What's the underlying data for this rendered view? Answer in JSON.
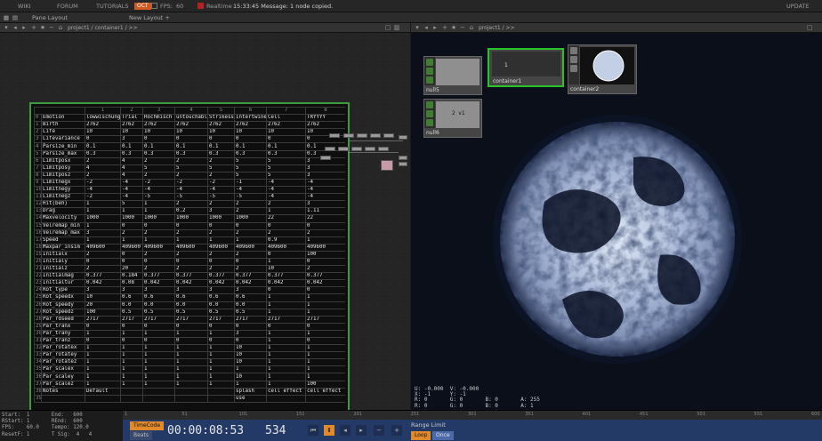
{
  "menu": {
    "wiki": "WIKI",
    "forum": "FORUM",
    "tutorials": "TUTORIALS",
    "oct_badge": "OCT",
    "fps_label": "FPS:",
    "fps_value": "60",
    "realtime": "Realtime",
    "message": "15:33:45 Message: 1 node copied.",
    "update": "UPDATE"
  },
  "panebar": {
    "pane_layout": "Pane Layout",
    "new_layout": "New Layout +"
  },
  "left_path": {
    "path": "project1 / container1 / >>"
  },
  "right_path": {
    "path": "project1 / >>"
  },
  "table": {
    "col_headers": [
      "",
      "1",
      "2",
      "3",
      "4",
      "5",
      "6",
      "7",
      "8"
    ],
    "rows": [
      [
        "0",
        "Emotion",
        "lowwischung",
        "Trial",
        "Hochmisch",
        "untouchable",
        "Strikess",
        "Intertwine",
        "Cell",
        "TRYYYY"
      ],
      [
        "1",
        "Birth",
        "2762",
        "2762",
        "2762",
        "2762",
        "2762",
        "2762",
        "2762",
        "2762"
      ],
      [
        "2",
        "Life",
        "10",
        "10",
        "10",
        "10",
        "10",
        "10",
        "10",
        "10"
      ],
      [
        "3",
        "Lifevariance",
        "0",
        "3",
        "0",
        "0",
        "0",
        "0",
        "0",
        "0"
      ],
      [
        "4",
        "Parsize_min",
        "0.1",
        "0.1",
        "0.1",
        "0.1",
        "0.1",
        "0.1",
        "0.1",
        "0.1"
      ],
      [
        "5",
        "Parsize_max",
        "0.3",
        "0.3",
        "0.3",
        "0.3",
        "0.3",
        "0.3",
        "0.3",
        "0.3"
      ],
      [
        "6",
        "Limitposx",
        "2",
        "4",
        "2",
        "2",
        "2",
        "5",
        "5",
        "3"
      ],
      [
        "7",
        "Limitposy",
        "4",
        "4",
        "5",
        "5",
        "5",
        "5",
        "5",
        "3"
      ],
      [
        "8",
        "Limitposz",
        "2",
        "4",
        "2",
        "2",
        "2",
        "5",
        "5",
        "3"
      ],
      [
        "9",
        "Limitnegx",
        "-2",
        "-4",
        "-2",
        "-2",
        "-2",
        "-1",
        "-4",
        "-4"
      ],
      [
        "10",
        "Limitnegy",
        "-4",
        "-4",
        "-4",
        "-4",
        "-4",
        "-4",
        "-4",
        "-4"
      ],
      [
        "11",
        "Limitnegz",
        "-2",
        "-4",
        "-5",
        "-5",
        "-5",
        "-5",
        "-4",
        "-4"
      ],
      [
        "12",
        "Hit(beh)",
        "1",
        "5",
        "1",
        "2",
        "2",
        "2",
        "2",
        "3"
      ],
      [
        "13",
        "Drag",
        "1",
        "1",
        "1",
        "0.2",
        "3",
        "2",
        "1",
        "1.11"
      ],
      [
        "14",
        "Maxvelocity",
        "1000",
        "1000",
        "1000",
        "1000",
        "1000",
        "1000",
        "22",
        "22"
      ],
      [
        "15",
        "Velremap_min",
        "1",
        "0",
        "0",
        "0",
        "0",
        "0",
        "0",
        "0"
      ],
      [
        "16",
        "Velremap_max",
        "3",
        "2",
        "2",
        "2",
        "2",
        "2",
        "2",
        "2"
      ],
      [
        "17",
        "Speed",
        "1",
        "1",
        "1",
        "1",
        "1",
        "1",
        "0.9",
        "1"
      ],
      [
        "18",
        "Maxpar_insim",
        "409600",
        "409600",
        "409600",
        "409600",
        "409600",
        "409600",
        "409600",
        "409600"
      ],
      [
        "19",
        "Initialx",
        "2",
        "0",
        "2",
        "2",
        "2",
        "2",
        "0",
        "100"
      ],
      [
        "20",
        "Initialy",
        "0",
        "0",
        "0",
        "0",
        "0",
        "0",
        "1",
        "0"
      ],
      [
        "21",
        "Initialz",
        "2",
        "20",
        "2",
        "2",
        "2",
        "2",
        "10",
        "2"
      ],
      [
        "22",
        "Initialmag",
        "0.377",
        "0.184",
        "0.377",
        "0.377",
        "0.377",
        "0.377",
        "0.377",
        "0.377"
      ],
      [
        "23",
        "Initialtur",
        "0.042",
        "0.08",
        "0.042",
        "0.042",
        "0.042",
        "0.042",
        "0.042",
        "0.042"
      ],
      [
        "24",
        "Rot_type",
        "3",
        "3",
        "3",
        "3",
        "3",
        "3",
        "0",
        "0"
      ],
      [
        "25",
        "Rot_speedx",
        "10",
        "0.6",
        "0.6",
        "0.6",
        "0.6",
        "0.6",
        "1",
        "1"
      ],
      [
        "26",
        "Rot_speedy",
        "20",
        "0.0",
        "0.0",
        "0.0",
        "0.0",
        "0.0",
        "1",
        "1"
      ],
      [
        "27",
        "Rot_speedz",
        "100",
        "0.5",
        "0.5",
        "0.5",
        "0.5",
        "0.5",
        "1",
        "1"
      ],
      [
        "28",
        "Par_rdseed",
        "2717",
        "2717",
        "2717",
        "2717",
        "2717",
        "2717",
        "2717",
        "2717"
      ],
      [
        "29",
        "Par_tranx",
        "0",
        "0",
        "0",
        "0",
        "0",
        "0",
        "0",
        "0"
      ],
      [
        "30",
        "Par_trany",
        "1",
        "1",
        "1",
        "1",
        "1",
        "3",
        "1",
        "1"
      ],
      [
        "31",
        "Par_tranz",
        "0",
        "0",
        "0",
        "0",
        "0",
        "0",
        "1",
        "0"
      ],
      [
        "32",
        "Par_rotatex",
        "1",
        "1",
        "1",
        "1",
        "1",
        "10",
        "1",
        "1"
      ],
      [
        "33",
        "Par_rotatey",
        "1",
        "1",
        "1",
        "1",
        "1",
        "10",
        "1",
        "1"
      ],
      [
        "34",
        "Par_rotatez",
        "1",
        "1",
        "1",
        "1",
        "1",
        "10",
        "1",
        "1"
      ],
      [
        "35",
        "Par_scalex",
        "1",
        "1",
        "1",
        "1",
        "1",
        "1",
        "1",
        "1"
      ],
      [
        "36",
        "Par_scaley",
        "1",
        "1",
        "1",
        "1",
        "1",
        "10",
        "1",
        "1"
      ],
      [
        "37",
        "Par_scalez",
        "1",
        "1",
        "1",
        "1",
        "1",
        "1",
        "1",
        "100"
      ],
      [
        "38",
        "Notes",
        "Default",
        "",
        "",
        "",
        "",
        "splash",
        "cell effect",
        "cell effect"
      ],
      [
        "39",
        "",
        "",
        "",
        "",
        "",
        "",
        "use",
        "",
        ""
      ]
    ],
    "label": "table1"
  },
  "nodes": {
    "null5": "null5",
    "null6": "null6",
    "container1": "container1",
    "container1_value": "1",
    "container2": "container2",
    "null6_value": "2 v1"
  },
  "info": {
    "text": "U: -0.000  V: -0.000\nX: -1      Y: -1\nR: 0       G: 0       B: 0       A: 255\nR: 0       G: 0       B: 0       A: 1"
  },
  "timeline": {
    "stats": "Start:  1       End:   600\nRStart: 1       REnd:  600\nFPS:    60.0    Tempo: 120.0\nResetF: 1       T Sig:  4   4",
    "timecode_btn": "TimeCode",
    "beats_btn": "Beats",
    "timecode": "00:00:08:53",
    "frame": "534",
    "range_limit": "Range Limit",
    "loop": "Loop",
    "once": "Once",
    "ticks": [
      "1",
      "51",
      "101",
      "151",
      "201",
      "251",
      "301",
      "351",
      "401",
      "451",
      "501",
      "551",
      "600"
    ]
  },
  "colors": {
    "accent_green": "#3f9a3f",
    "timeline_blue": "#233a66",
    "orange": "#cf5a22"
  }
}
